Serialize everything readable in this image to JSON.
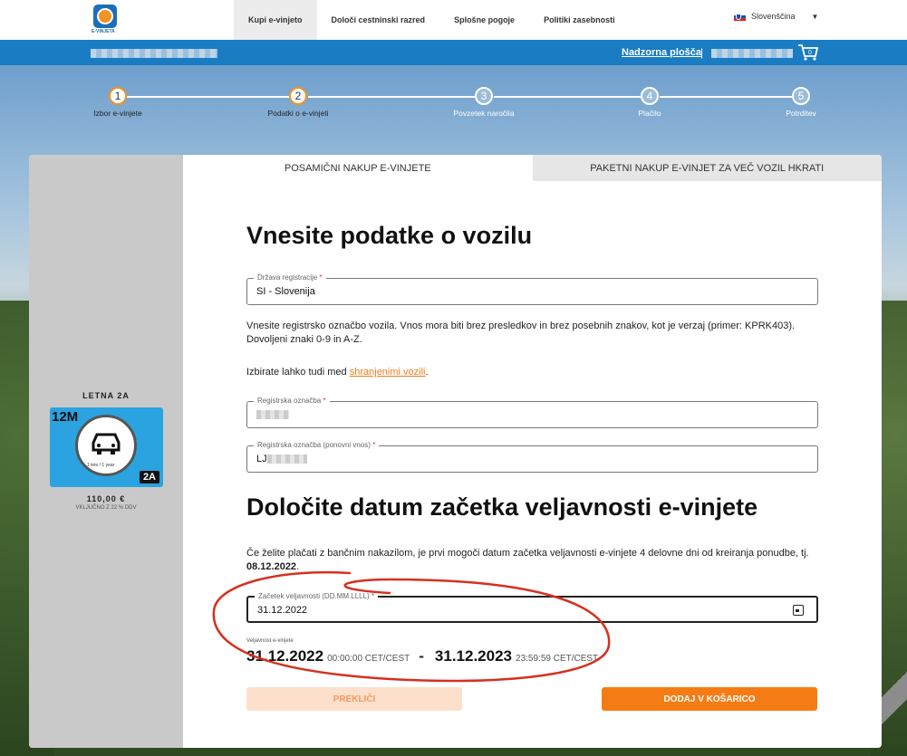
{
  "nav": {
    "logo_text": "E-VINJETA",
    "items": [
      {
        "label": "Kupi e-vinjeto",
        "active": true
      },
      {
        "label": "Določi cestninski razred",
        "active": false
      },
      {
        "label": "Splošne pogoje",
        "active": false
      },
      {
        "label": "Politiki zasebnosti",
        "active": false
      }
    ],
    "language": "Slovenščina"
  },
  "bluebar": {
    "dashboard_link": "Nadzorna plošča",
    "separator": "|",
    "cart_count": "0"
  },
  "steps": [
    {
      "num": "1",
      "label": "Izbor e-vinjete",
      "done": true
    },
    {
      "num": "2",
      "label": "Podatki o e-vinjeti",
      "done": true
    },
    {
      "num": "3",
      "label": "Povzetek naročila",
      "done": false
    },
    {
      "num": "4",
      "label": "Plačilo",
      "done": false
    },
    {
      "num": "5",
      "label": "Potrditev",
      "done": false
    }
  ],
  "sidebar": {
    "title": "LETNA 2A",
    "vignette_period": "12M",
    "vignette_sub": "1 leto / 1 year",
    "vignette_class": "2A",
    "price": "110,00 €",
    "vat_note": "VKLJUČNO Z 22 % DDV"
  },
  "tabs": [
    {
      "label": "POSAMIČNI NAKUP E-VINJETE",
      "active": true
    },
    {
      "label": "PAKETNI NAKUP E-VINJET ZA VEČ VOZIL HKRATI",
      "active": false
    }
  ],
  "vehicle": {
    "heading": "Vnesite podatke o vozilu",
    "country_label": "Država registracije",
    "country_value": "SI - Slovenija",
    "instructions": "Vnesite registrsko označbo vozila. Vnos mora biti brez presledkov in brez posebnih znakov, kot je verzaj (primer: KPRK403). Dovoljeni znaki 0-9 in A-Z.",
    "saved_prefix": "Izbirate lahko tudi med ",
    "saved_link": "shranjenimi vozili",
    "saved_suffix": ".",
    "plate_label": "Registrska označba",
    "plate_repeat_label": "Registrska označba (ponovni vnos)",
    "plate_repeat_value": "LJ",
    "required_mark": "*"
  },
  "validity": {
    "heading": "Določite datum začetka veljavnosti e-vinjete",
    "bank_note": "Če želite plačati z bančnim nakazilom, je prvi mogoči datum začetka veljavnosti e-vinjete 4 delovne dni od kreiranja ponudbe, tj. ",
    "bank_date": "08.12.2022",
    "bank_suffix": ".",
    "start_label": "Začetek veljavnosti (DD.MM.LLLL)",
    "start_value": "31.12.2022",
    "range_label": "Veljavnost e-vinjete",
    "from_date": "31.12.2022",
    "from_time": "00:00:00 CET/CEST",
    "dash": "-",
    "to_date": "31.12.2023",
    "to_time": "23:59:59 CET/CEST"
  },
  "buttons": {
    "cancel": "PREKLIČI",
    "add": "DODAJ V KOŠARICO"
  },
  "colors": {
    "brand_blue": "#1a7cc2",
    "accent_orange": "#f57c15",
    "annotation_red": "#d6301e"
  }
}
